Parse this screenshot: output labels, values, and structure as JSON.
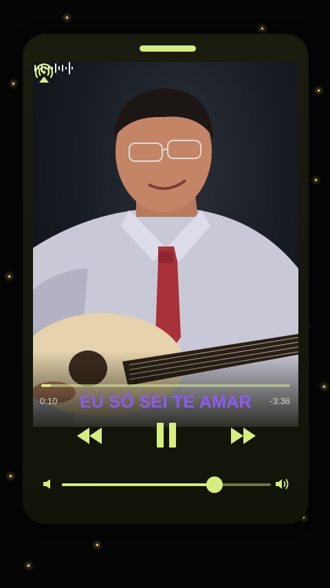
{
  "player": {
    "song_title": "EU SÓ SEI TE AMAR",
    "time_elapsed": "0:10",
    "time_remaining": "-3:36",
    "progress": 0.04,
    "volume": 0.73
  },
  "icons": {
    "prev": "rewind-icon",
    "pause": "pause-icon",
    "next": "fast-forward-icon",
    "volume_low": "speaker-low-icon",
    "volume_high": "speaker-high-icon",
    "audio_wave": "audio-wave-icon",
    "cast": "airplay-icon"
  },
  "colors": {
    "accent": "#d5ee7e",
    "title": "#8b5cf6",
    "background": "#050505"
  }
}
